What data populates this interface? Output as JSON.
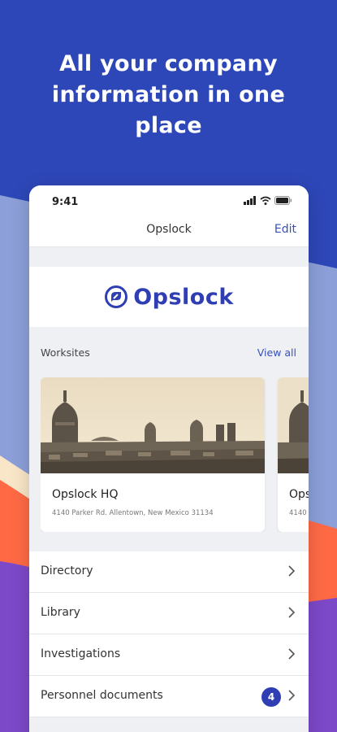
{
  "headline": "All your company information in one place",
  "colors": {
    "background": "#2e47b8",
    "brand": "#2f3fb3",
    "accent_orange": "#ff6a45",
    "accent_purple": "#7c49c9",
    "accent_cream": "#f9e6c8"
  },
  "status_bar": {
    "time": "9:41",
    "icons": [
      "signal-icon",
      "wifi-icon",
      "battery-icon"
    ]
  },
  "nav": {
    "title": "Opslock",
    "edit_label": "Edit"
  },
  "logo": {
    "text": "Opslock",
    "icon": "opslock-logo-icon"
  },
  "worksites": {
    "label": "Worksites",
    "view_all_label": "View all",
    "cards": [
      {
        "title": "Opslock HQ",
        "address": "4140 Parker Rd. Allentown, New Mexico 31134"
      },
      {
        "title": "Ops",
        "address": "4140"
      }
    ]
  },
  "menu": {
    "items": [
      {
        "label": "Directory",
        "badge": null
      },
      {
        "label": "Library",
        "badge": null
      },
      {
        "label": "Investigations",
        "badge": null
      },
      {
        "label": "Personnel documents",
        "badge": "4"
      }
    ]
  }
}
